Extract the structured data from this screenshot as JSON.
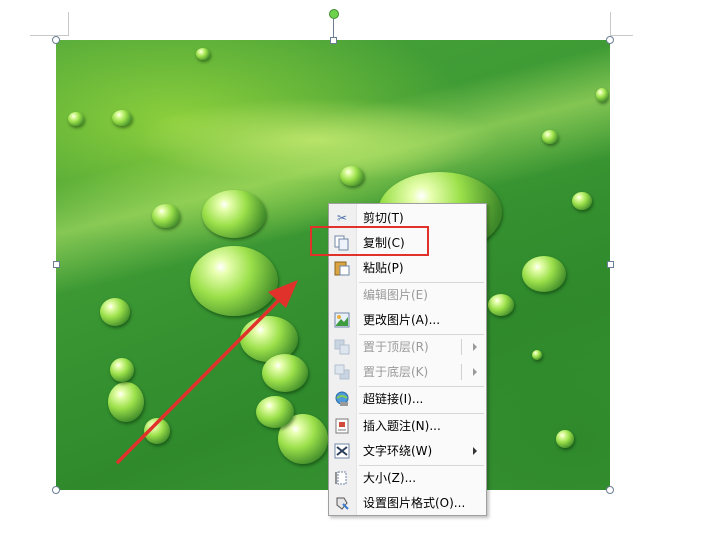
{
  "image": {
    "description_icon": "water-drops-leaf-photo"
  },
  "colors": {
    "annotation_red": "#e0322a",
    "handle_border": "#6b7e95",
    "rotate_handle": "#6fd24f"
  },
  "context_menu": {
    "items": [
      {
        "label": "剪切(T)",
        "icon": "cut-icon",
        "enabled": true,
        "submenu": false
      },
      {
        "label": "复制(C)",
        "icon": "copy-icon",
        "enabled": true,
        "submenu": false,
        "highlighted": true
      },
      {
        "label": "粘贴(P)",
        "icon": "paste-icon",
        "enabled": true,
        "submenu": false
      },
      {
        "label": "编辑图片(E)",
        "icon": "edit-picture-icon",
        "enabled": false,
        "submenu": false
      },
      {
        "label": "更改图片(A)...",
        "icon": "change-picture-icon",
        "enabled": true,
        "submenu": false
      },
      {
        "label": "置于顶层(R)",
        "icon": "bring-to-front-icon",
        "enabled": false,
        "submenu": true
      },
      {
        "label": "置于底层(K)",
        "icon": "send-to-back-icon",
        "enabled": false,
        "submenu": true
      },
      {
        "label": "超链接(I)...",
        "icon": "hyperlink-icon",
        "enabled": true,
        "submenu": false
      },
      {
        "label": "插入题注(N)...",
        "icon": "insert-caption-icon",
        "enabled": true,
        "submenu": false
      },
      {
        "label": "文字环绕(W)",
        "icon": "text-wrap-icon",
        "enabled": true,
        "submenu": true
      },
      {
        "label": "大小(Z)...",
        "icon": "size-icon",
        "enabled": true,
        "submenu": false
      },
      {
        "label": "设置图片格式(O)...",
        "icon": "format-picture-icon",
        "enabled": true,
        "submenu": false
      }
    ]
  }
}
